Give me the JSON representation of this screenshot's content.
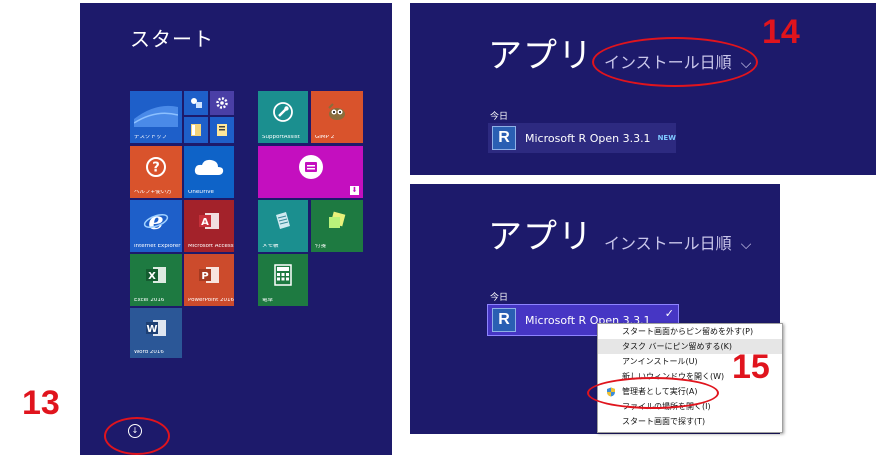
{
  "start_screen": {
    "title": "スタート",
    "tiles": [
      {
        "name": "desktop",
        "label": "デスクトップ",
        "color": "#1e5fc9"
      },
      {
        "name": "help",
        "label": "ヘルプ+使い方",
        "color": "#d9532c"
      },
      {
        "name": "onedrive",
        "label": "OneDrive",
        "color": "#0e63c8"
      },
      {
        "name": "ie",
        "label": "Internet Explorer",
        "color": "#1e5fc9"
      },
      {
        "name": "access",
        "label": "Microsoft Access 2010",
        "color": "#a3222a"
      },
      {
        "name": "excel",
        "label": "Excel 2016",
        "color": "#1e7a41"
      },
      {
        "name": "powerpoint",
        "label": "PowerPoint 2016",
        "color": "#cc4b2c"
      },
      {
        "name": "word",
        "label": "Word 2016",
        "color": "#2b5797"
      },
      {
        "name": "supportassist",
        "label": "SupportAssist",
        "color": "#1b8f8f"
      },
      {
        "name": "gimp",
        "label": "GIMP 2",
        "color": "#d9532c"
      },
      {
        "name": "memo",
        "label": "メモ帳",
        "color": "#1b8f8f"
      },
      {
        "name": "fusen",
        "label": "付箋",
        "color": "#1e7a41"
      },
      {
        "name": "calc",
        "label": "電卓",
        "color": "#1e7a41"
      }
    ]
  },
  "apps_view": {
    "title": "アプリ",
    "sort_label": "インストール日順",
    "sort_chevron": "⌵",
    "group_today": "今日",
    "app_name": "Microsoft R Open 3.3.1",
    "new_badge": "NEW",
    "r_letter": "R",
    "check": "✓"
  },
  "context_menu": {
    "items": [
      "スタート画面からピン留めを外す(P)",
      "タスク バーにピン留めする(K)",
      "アンインストール(U)",
      "新しいウィンドウを開く(W)",
      "管理者として実行(A)",
      "ファイルの場所を開く(I)",
      "スタート画面で探す(T)"
    ]
  },
  "steps": {
    "s13": "13",
    "s14": "14",
    "s15": "15"
  },
  "colors": {
    "bg": "#1d1a6b",
    "annotation": "#e0141d"
  }
}
